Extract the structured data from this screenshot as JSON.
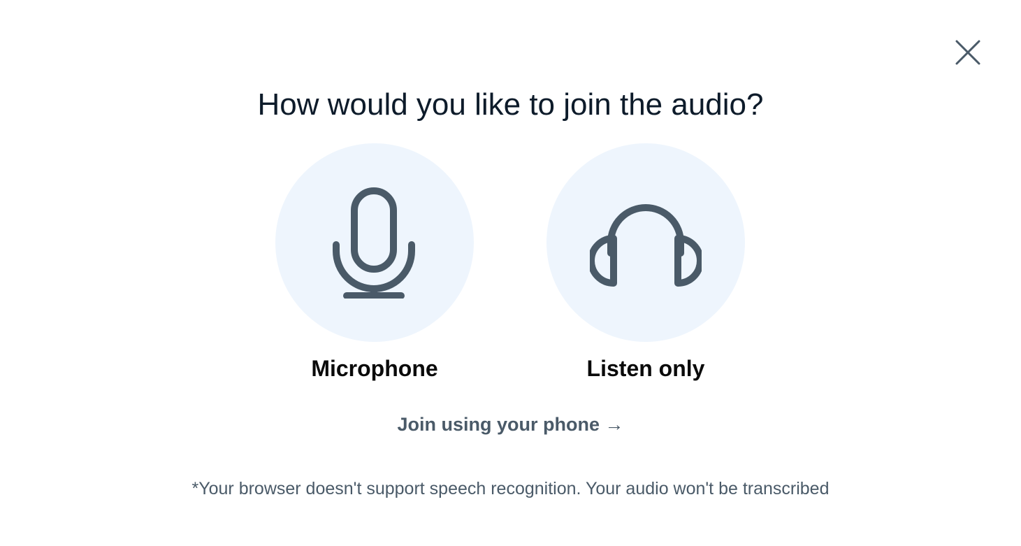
{
  "dialog": {
    "title": "How would you like to join the audio?",
    "close_icon": "close-icon",
    "options": [
      {
        "label": "Microphone",
        "icon": "microphone-icon"
      },
      {
        "label": "Listen only",
        "icon": "headphones-icon"
      }
    ],
    "phone_link_label": "Join using your phone →",
    "note": "*Your browser doesn't support speech recognition. Your audio won't be transcribed"
  },
  "colors": {
    "icon": "#4a5a68",
    "circle_bg": "#eef5fd",
    "title": "#0d1b2a",
    "label": "#0a0a0a",
    "secondary_text": "#4a5a68"
  }
}
